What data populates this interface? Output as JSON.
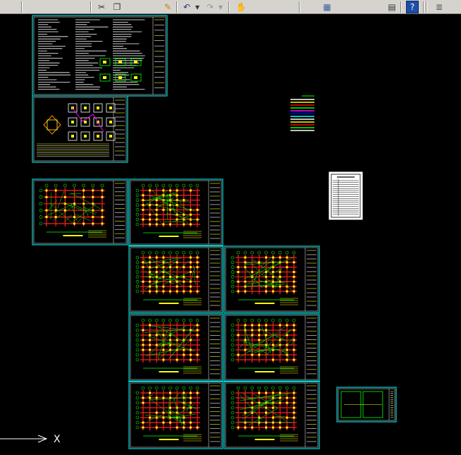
{
  "toolbar": {
    "icons": [
      {
        "name": "save-icon",
        "glyph": "",
        "color": "#3a5fa0"
      },
      {
        "name": "print-icon",
        "glyph": "",
        "color": "#555555"
      },
      {
        "name": "plot-preview-icon",
        "glyph": "",
        "color": "#555555"
      },
      {
        "name": "publish-icon",
        "glyph": "",
        "color": "#b07a20"
      },
      {
        "name": "3d-dwf-icon",
        "glyph": "",
        "color": "#3a7a3a"
      },
      {
        "name": "cut-icon",
        "glyph": "✂",
        "color": "#333333"
      },
      {
        "name": "copy-icon",
        "glyph": "❐",
        "color": "#333333"
      },
      {
        "name": "paste-icon",
        "glyph": "",
        "color": "#b08030"
      },
      {
        "name": "match-properties-icon",
        "glyph": "✎",
        "color": "#d08000"
      },
      {
        "name": "undo-icon",
        "glyph": "↶",
        "color": "#1a3a8a"
      },
      {
        "name": "undo-dropdown-icon",
        "glyph": "▾",
        "color": "#333333"
      },
      {
        "name": "redo-icon",
        "glyph": "↷",
        "color": "#999999"
      },
      {
        "name": "redo-dropdown-icon",
        "glyph": "▾",
        "color": "#999999"
      },
      {
        "name": "pan-icon",
        "glyph": "✋",
        "color": "#4a3a8a"
      },
      {
        "name": "zoom-realtime-icon",
        "glyph": "",
        "color": "#333333"
      },
      {
        "name": "zoom-window-icon",
        "glyph": "",
        "color": "#333333"
      },
      {
        "name": "zoom-previous-icon",
        "glyph": "",
        "color": "#333333"
      },
      {
        "name": "properties-icon",
        "glyph": "",
        "color": "#6a3a9a"
      },
      {
        "name": "design-center-icon",
        "glyph": "▦",
        "color": "#3a5fa0"
      },
      {
        "name": "tool-palettes-icon",
        "glyph": "",
        "color": "#555555"
      },
      {
        "name": "sheet-set-icon",
        "glyph": "",
        "color": "#3a7a9a"
      },
      {
        "name": "markup-icon",
        "glyph": "",
        "color": "#c03030"
      },
      {
        "name": "calculator-icon",
        "glyph": "▤",
        "color": "#333333"
      },
      {
        "name": "help-icon",
        "glyph": "?",
        "color": "#ffffff"
      },
      {
        "name": "layers-icon",
        "glyph": "≣",
        "color": "#555555"
      },
      {
        "name": "light-bulb-icon",
        "glyph": "",
        "color": "#c0a000"
      }
    ]
  },
  "ucs": {
    "x_label": "X"
  },
  "colors": {
    "frame": "#00ffff",
    "background": "#000000",
    "grid_line": "#ff2020",
    "column": "#ffff00",
    "dimension": "#00ff00",
    "text": "#ffffff",
    "ucs": "#ffffff"
  }
}
